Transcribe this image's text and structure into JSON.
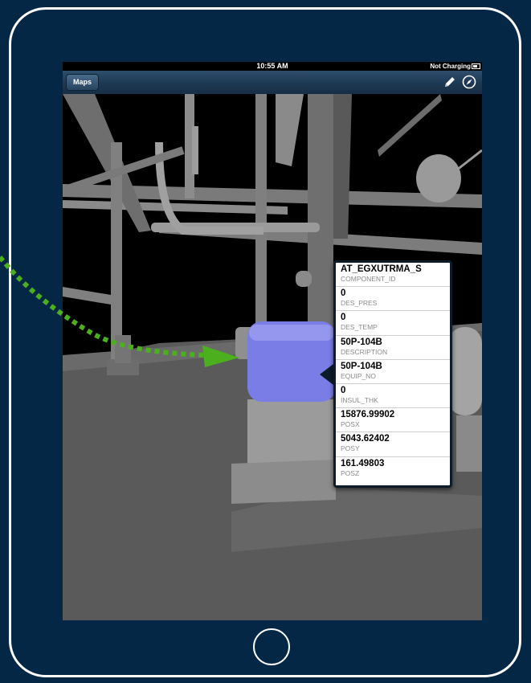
{
  "status_bar": {
    "time": "10:55 AM",
    "charging": "Not Charging"
  },
  "toolbar": {
    "maps_label": "Maps",
    "edit_icon": "pencil-icon",
    "locate_icon": "compass-icon"
  },
  "callout": {
    "rows": [
      {
        "value": "AT_EGXUTRMA_S",
        "label": "COMPONENT_ID"
      },
      {
        "value": "0",
        "label": "DES_PRES"
      },
      {
        "value": "0",
        "label": "DES_TEMP"
      },
      {
        "value": "50P-104B",
        "label": "DESCRIPTION"
      },
      {
        "value": "50P-104B",
        "label": "EQUIP_NO"
      },
      {
        "value": "0",
        "label": "INSUL_THK"
      },
      {
        "value": "15876.99902",
        "label": "POSX"
      },
      {
        "value": "5043.62402",
        "label": "POSY"
      },
      {
        "value": "161.49803",
        "label": "POSZ"
      }
    ]
  },
  "colors": {
    "background": "#032745",
    "highlight": "#7b7de6",
    "guide_arrow": "#4caf1e"
  }
}
